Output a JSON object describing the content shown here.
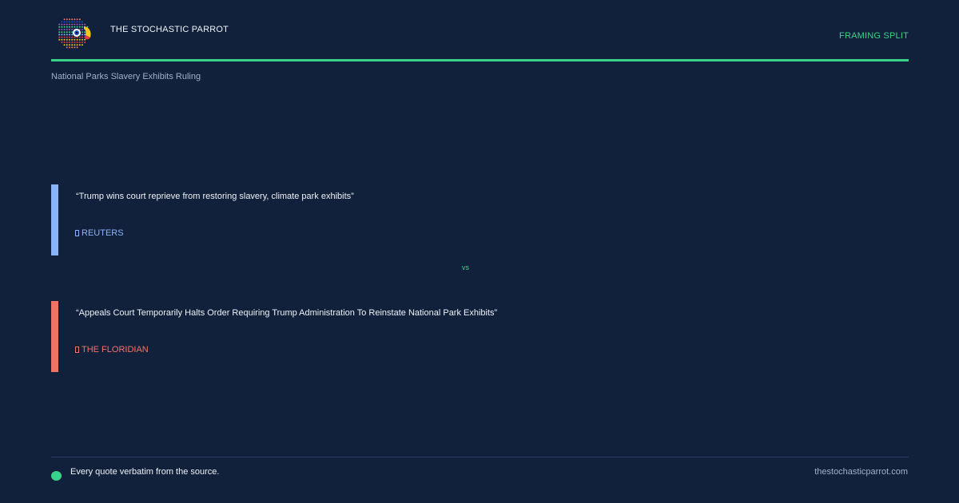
{
  "header": {
    "brand": "THE STOCHASTIC PARROT",
    "tag": "FRAMING SPLIT",
    "logo_icon": "parrot-logo-icon"
  },
  "subtitle": "National Parks Slavery Exhibits Ruling",
  "quotes": [
    {
      "text": "“Trump wins court reprieve from restoring slavery, climate park exhibits”",
      "source": "REUTERS",
      "accent": "#8ab4f8"
    },
    {
      "text": "“Appeals Court Temporarily Halts Order Requiring Trump Administration To Reinstate National Park Exhibits”",
      "source": "THE FLORIDIAN",
      "accent": "#f07466"
    }
  ],
  "vs_label": "vs",
  "footer": {
    "note": "Every quote verbatim from the source.",
    "site": "thestochasticparrot.com"
  },
  "colors": {
    "background": "#12213b",
    "accent_green": "#3ad28b"
  }
}
